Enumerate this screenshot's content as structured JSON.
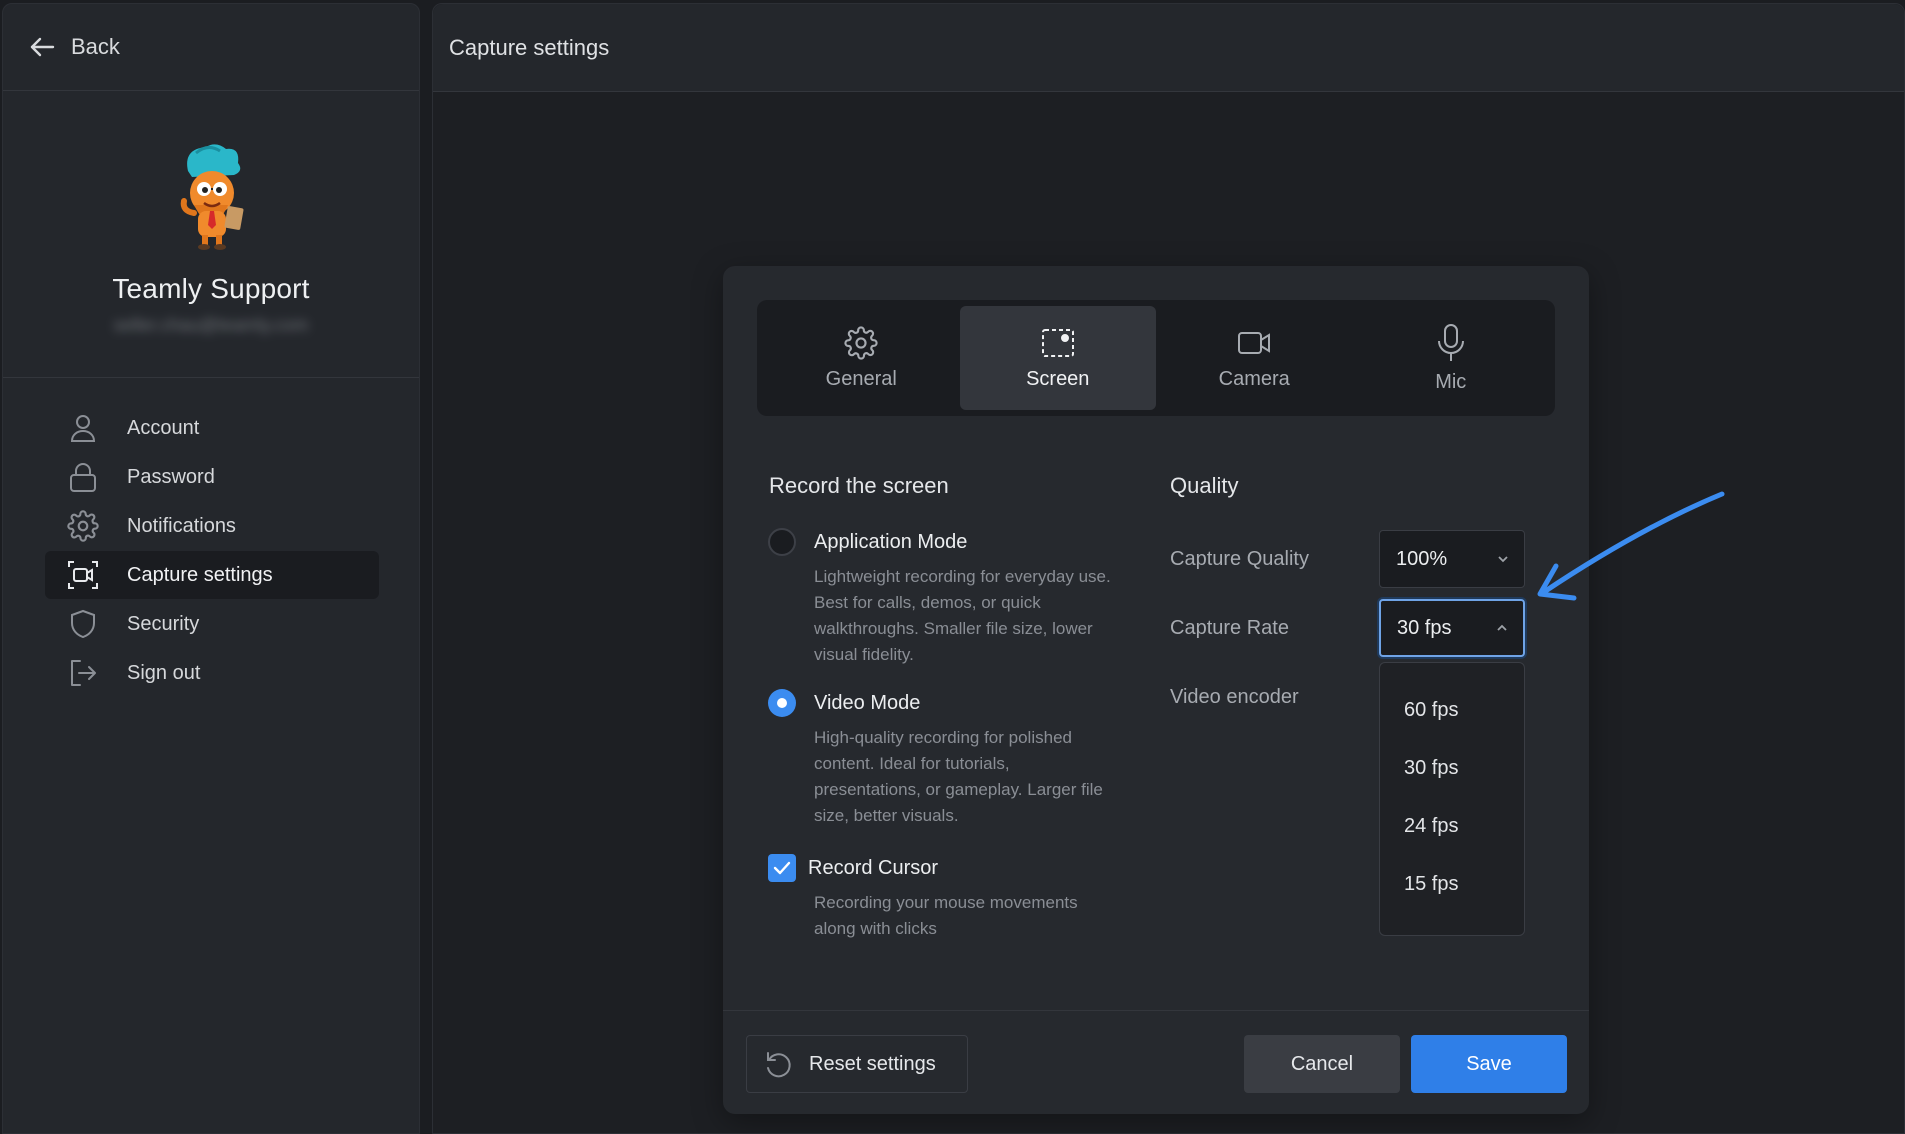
{
  "sidebar": {
    "back_label": "Back",
    "profile": {
      "name": "Teamly Support",
      "email": "seller.chau@teamly.com"
    },
    "items": [
      {
        "label": "Account",
        "icon": "user-icon"
      },
      {
        "label": "Password",
        "icon": "lock-icon"
      },
      {
        "label": "Notifications",
        "icon": "gear-icon"
      },
      {
        "label": "Capture settings",
        "icon": "capture-icon",
        "active": true
      },
      {
        "label": "Security",
        "icon": "shield-icon"
      },
      {
        "label": "Sign out",
        "icon": "sign-out-icon"
      }
    ]
  },
  "main": {
    "title": "Capture settings"
  },
  "dialog": {
    "tabs": [
      {
        "label": "General",
        "icon": "gear-icon"
      },
      {
        "label": "Screen",
        "icon": "screen-select-icon",
        "active": true
      },
      {
        "label": "Camera",
        "icon": "camera-icon"
      },
      {
        "label": "Mic",
        "icon": "mic-icon"
      }
    ],
    "record": {
      "title": "Record the screen",
      "application_mode": {
        "label": "Application Mode",
        "desc_lines": [
          "Lightweight recording for everyday use.",
          "Best for calls, demos, or quick",
          "walkthroughs. Smaller file size, lower",
          "visual fidelity."
        ],
        "checked": false
      },
      "video_mode": {
        "label": "Video Mode",
        "desc_lines": [
          "High-quality recording for polished",
          "content. Ideal for tutorials,",
          "presentations, or gameplay. Larger file",
          "size, better visuals."
        ],
        "checked": true
      },
      "record_cursor": {
        "label": "Record Cursor",
        "desc_lines": [
          "Recording your mouse movements",
          "along with clicks"
        ],
        "checked": true
      }
    },
    "quality": {
      "title": "Quality",
      "capture_quality": {
        "label": "Capture Quality",
        "value": "100%"
      },
      "capture_rate": {
        "label": "Capture Rate",
        "value": "30 fps",
        "open": true
      },
      "video_encoder": {
        "label": "Video encoder"
      },
      "rate_options": [
        "60 fps",
        "30 fps",
        "24 fps",
        "15 fps"
      ]
    },
    "footer": {
      "reset_label": "Reset settings",
      "cancel_label": "Cancel",
      "save_label": "Save"
    }
  },
  "colors": {
    "accent": "#2f7fe8",
    "annotation_arrow": "#3b8cf0"
  }
}
